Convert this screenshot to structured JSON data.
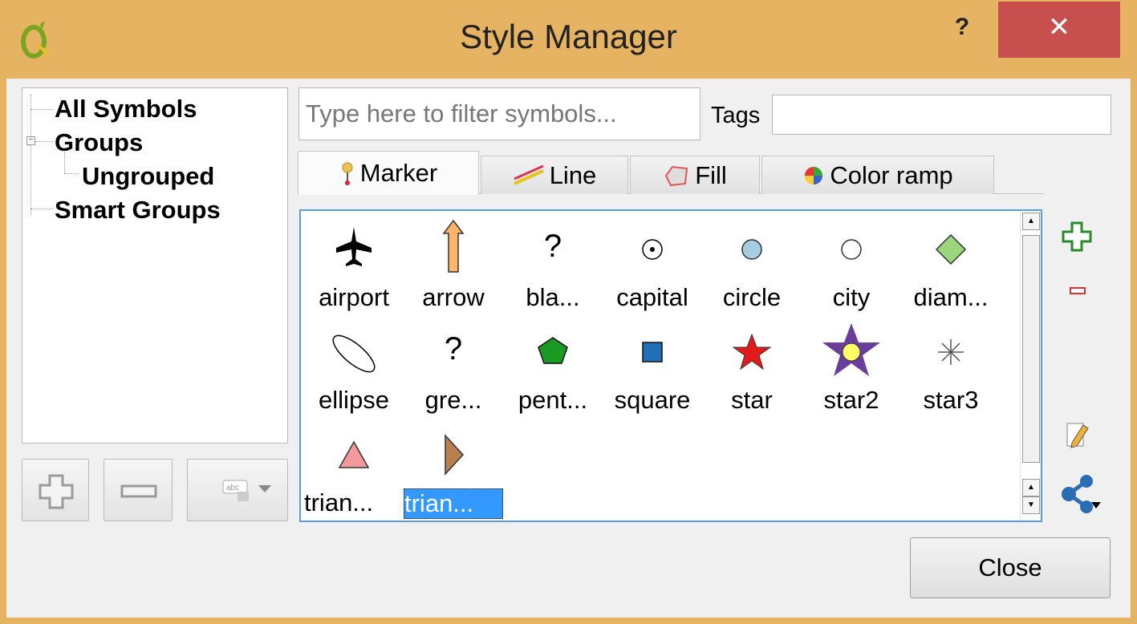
{
  "window": {
    "title": "Style Manager",
    "help_label": "?",
    "close_label": "✕"
  },
  "tree": {
    "items": [
      {
        "label": "All Symbols"
      },
      {
        "label": "Groups"
      },
      {
        "label": "Ungrouped"
      },
      {
        "label": "Smart Groups"
      }
    ]
  },
  "filter": {
    "placeholder": "Type here to filter symbols...",
    "value": ""
  },
  "tags": {
    "label": "Tags",
    "value": ""
  },
  "tabs": [
    {
      "label": "Marker",
      "icon": "marker-icon",
      "active": true
    },
    {
      "label": "Line",
      "icon": "line-icon",
      "active": false
    },
    {
      "label": "Fill",
      "icon": "fill-icon",
      "active": false
    },
    {
      "label": "Color ramp",
      "icon": "color-ramp-icon",
      "active": false
    }
  ],
  "symbols": [
    {
      "label": "airport",
      "icon": "airplane-icon"
    },
    {
      "label": "arrow",
      "icon": "arrow-up-icon"
    },
    {
      "label": "bla...",
      "icon": "question-icon"
    },
    {
      "label": "capital",
      "icon": "dotted-circle-icon"
    },
    {
      "label": "circle",
      "icon": "circle-icon"
    },
    {
      "label": "city",
      "icon": "hollow-circle-icon"
    },
    {
      "label": "diam...",
      "icon": "diamond-icon"
    },
    {
      "label": "ellipse",
      "icon": "ellipse-icon"
    },
    {
      "label": "gre...",
      "icon": "question-icon"
    },
    {
      "label": "pent...",
      "icon": "pentagon-icon"
    },
    {
      "label": "square",
      "icon": "square-icon"
    },
    {
      "label": "star",
      "icon": "star-icon"
    },
    {
      "label": "star2",
      "icon": "star2-icon"
    },
    {
      "label": "star3",
      "icon": "asterisk-icon"
    },
    {
      "label": "trian...",
      "icon": "triangle-icon"
    },
    {
      "label": "trian...",
      "icon": "triangle-right-icon",
      "selected": true
    }
  ],
  "buttons": {
    "close_label": "Close"
  },
  "colors": {
    "frame": "#e6b363",
    "close_button": "#c7504f",
    "selection": "#3399ff",
    "grid_border": "#569de5"
  }
}
